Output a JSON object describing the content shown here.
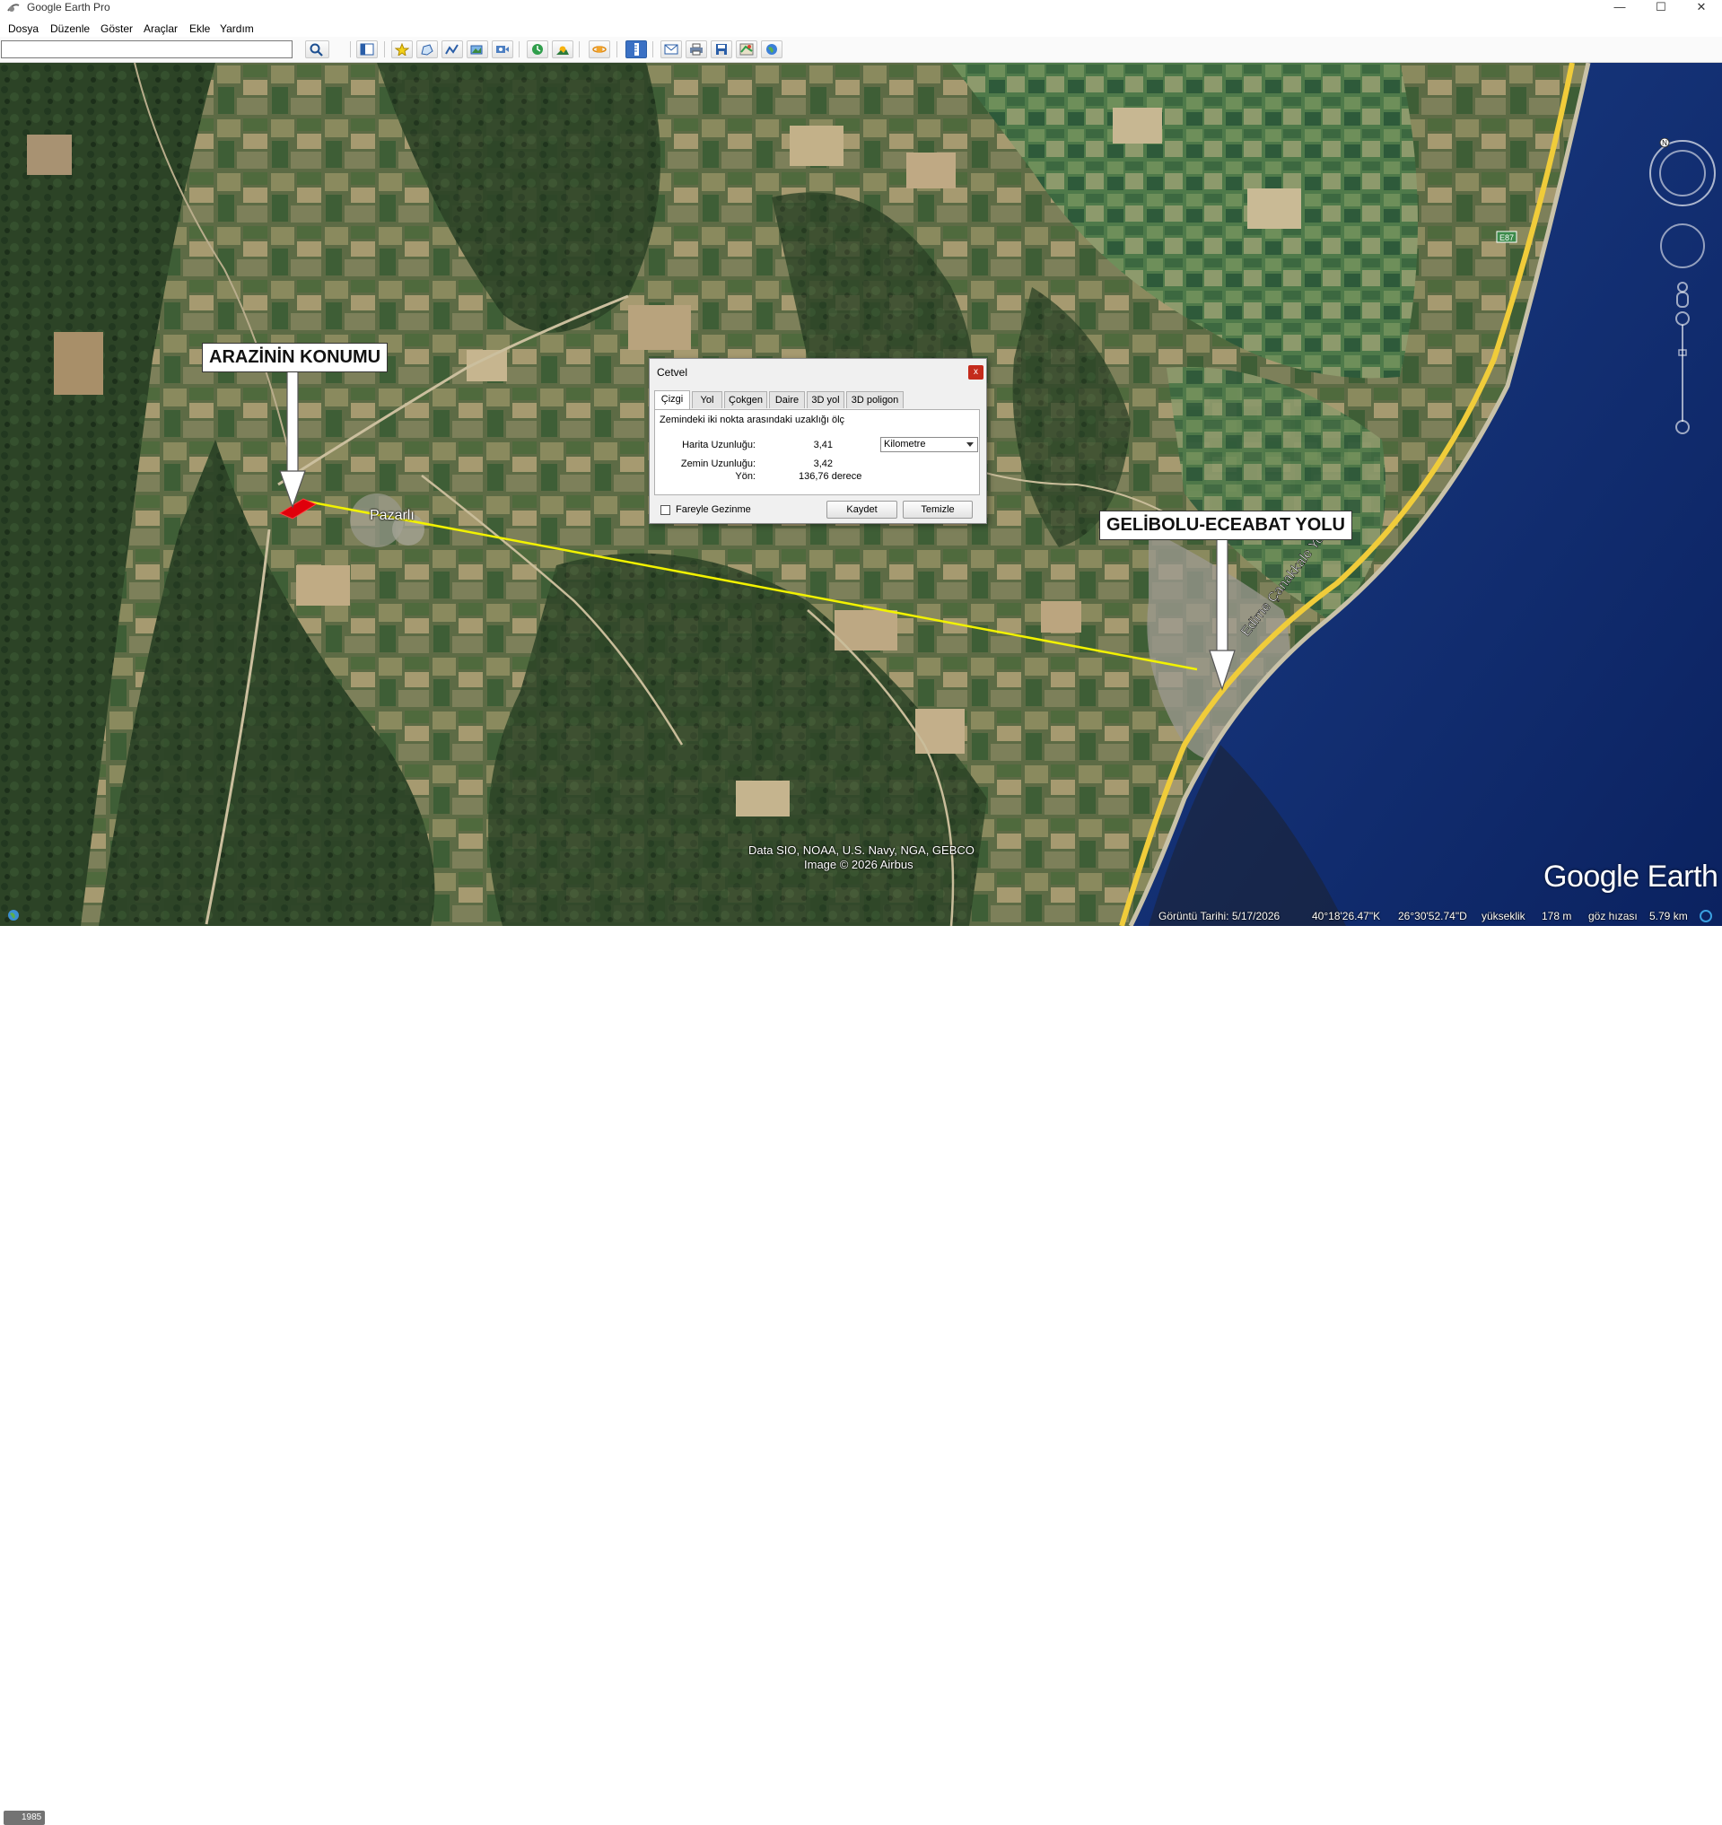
{
  "window": {
    "title": "Google Earth Pro",
    "minimize": "—",
    "maximize": "☐",
    "close": "✕"
  },
  "menu": [
    "Dosya",
    "Düzenle",
    "Göster",
    "Araçlar",
    "Ekle",
    "Yardım"
  ],
  "search": {
    "value": "",
    "placeholder": ""
  },
  "toolbar_icons": [
    "search-icon",
    "sidebar-icon",
    "placemark-icon",
    "polygon-icon",
    "path-icon",
    "image-overlay-icon",
    "record-tour-icon",
    "historical-imagery-icon",
    "sunlight-icon",
    "planets-icon",
    "ruler-icon",
    "email-icon",
    "print-icon",
    "save-image-icon",
    "view-maps-icon",
    "earth-icon"
  ],
  "map": {
    "callout_land": "ARAZİNİN KONUMU",
    "callout_road": "GELİBOLU-ECEABAT YOLU",
    "village_label": "Pazarlı",
    "road_label": "Edirne Çanakkale Yolu",
    "highway_shield": "E87",
    "attribution_line1": "Data SIO, NOAA, U.S. Navy, NGA, GEBCO",
    "attribution_line2": "Image © 2026 Airbus",
    "logo": "Google Earth",
    "year": "1985"
  },
  "ruler_dialog": {
    "title": "Cetvel",
    "close_label": "x",
    "tabs": [
      "Çizgi",
      "Yol",
      "Çokgen",
      "Daire",
      "3D yol",
      "3D poligon"
    ],
    "active_tab": "Çizgi",
    "description": "Zemindeki iki nokta arasındaki uzaklığı ölç",
    "map_length_label": "Harita Uzunluğu:",
    "map_length_value": "3,41",
    "unit": "Kilometre",
    "ground_length_label": "Zemin Uzunluğu:",
    "ground_length_value": "3,42",
    "heading_label": "Yön:",
    "heading_value": "136,76 derece",
    "mouse_nav_label": "Fareyle Gezinme",
    "save_button": "Kaydet",
    "clear_button": "Temizle"
  },
  "status": {
    "imagery_date": "Görüntü Tarihi: 5/17/2026",
    "latitude": "40°18'26.47\"K",
    "longitude": "26°30'52.74\"D",
    "elevation_label": "yükseklik",
    "elevation_value": "178 m",
    "eye_alt_label": "göz hızası",
    "eye_alt_value": "5.79 km"
  },
  "colors": {
    "measure_line": "#f2f200",
    "land_marker": "#e0000b",
    "highway": "#f0cc3a",
    "sea": "#0d2a6e"
  }
}
